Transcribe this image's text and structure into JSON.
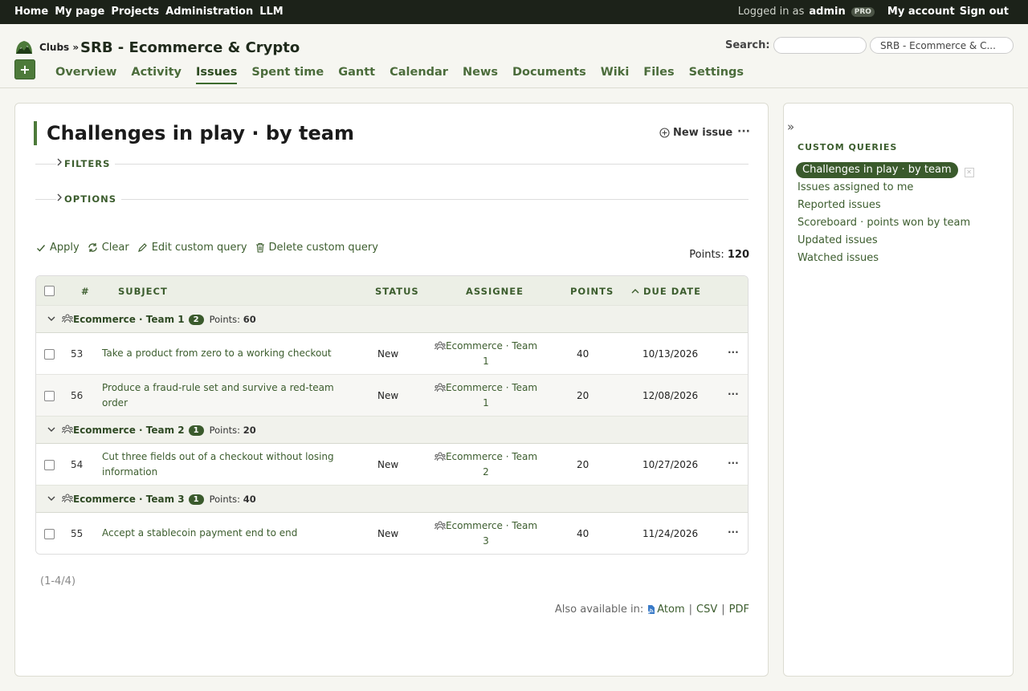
{
  "topbar": {
    "nav": [
      "Home",
      "My page",
      "Projects",
      "Administration",
      "LLM"
    ],
    "logged_in_prefix": "Logged in as",
    "user": "admin",
    "user_badge": "PRO",
    "my_account": "My account",
    "sign_out": "Sign out"
  },
  "header": {
    "breadcrumb": "Clubs »",
    "project_title": "SRB - Ecommerce & Crypto",
    "new_button": "+",
    "search_label": "Search:",
    "search_value": "",
    "project_jump": "SRB - Ecommerce & C...",
    "menu": [
      "Overview",
      "Activity",
      "Issues",
      "Spent time",
      "Gantt",
      "Calendar",
      "News",
      "Documents",
      "Wiki",
      "Files",
      "Settings"
    ],
    "active_menu": "Issues"
  },
  "main": {
    "title": "Challenges in play · by team",
    "new_issue": "New issue",
    "more": "···",
    "filters_label": "FILTERS",
    "options_label": "OPTIONS",
    "actions": {
      "apply": "Apply",
      "clear": "Clear",
      "edit": "Edit custom query",
      "delete": "Delete custom query"
    },
    "points_label": "Points:",
    "points_total": "120",
    "columns": {
      "id": "#",
      "subject": "SUBJECT",
      "status": "STATUS",
      "assignee": "ASSIGNEE",
      "points": "POINTS",
      "due_date": "DUE DATE"
    },
    "groups": [
      {
        "name": "Ecommerce · Team 1",
        "count": "2",
        "points_label": "Points:",
        "points": "60",
        "rows": [
          {
            "id": "53",
            "subject": "Take a product from zero to a working checkout",
            "status": "New",
            "assignee_line1": "Ecommerce · Team",
            "assignee_line2": "1",
            "points": "40",
            "due": "10/13/2026"
          },
          {
            "id": "56",
            "subject_line1": "Produce a fraud-rule set and survive a red-team",
            "subject_line2": "order",
            "status": "New",
            "assignee_line1": "Ecommerce · Team",
            "assignee_line2": "1",
            "points": "20",
            "due": "12/08/2026"
          }
        ]
      },
      {
        "name": "Ecommerce · Team 2",
        "count": "1",
        "points_label": "Points:",
        "points": "20",
        "rows": [
          {
            "id": "54",
            "subject_line1": "Cut three fields out of a checkout without losing",
            "subject_line2": "information",
            "status": "New",
            "assignee_line1": "Ecommerce · Team",
            "assignee_line2": "2",
            "points": "20",
            "due": "10/27/2026"
          }
        ]
      },
      {
        "name": "Ecommerce · Team 3",
        "count": "1",
        "points_label": "Points:",
        "points": "40",
        "rows": [
          {
            "id": "55",
            "subject": "Accept a stablecoin payment end to end",
            "status": "New",
            "assignee_line1": "Ecommerce · Team",
            "assignee_line2": "3",
            "points": "40",
            "due": "11/24/2026"
          }
        ]
      }
    ],
    "row_more": "···",
    "pagination": "(1-4/4)",
    "also_available": "Also available in:",
    "formats": [
      "Atom",
      "CSV",
      "PDF"
    ],
    "format_sep": "|"
  },
  "sidebar": {
    "collapse": "»",
    "heading": "CUSTOM QUERIES",
    "queries": [
      "Challenges in play · by team",
      "Issues assigned to me",
      "Reported issues",
      "Scoreboard · points won by team",
      "Updated issues",
      "Watched issues"
    ]
  },
  "colors": {
    "topbar_bg": "#1c2219",
    "accent": "#3a5a2c",
    "link": "#3c5d2e"
  }
}
